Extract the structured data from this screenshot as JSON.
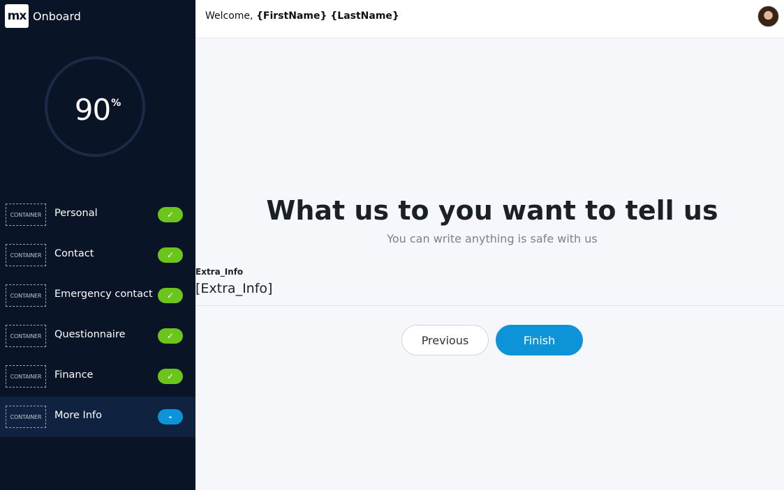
{
  "brand": {
    "logo_text": "mx",
    "name": "Onboard"
  },
  "progress": {
    "value": "90",
    "unit": "%"
  },
  "steps": [
    {
      "container": "CONTAINER",
      "label": "Personal",
      "badge": "✓",
      "status": "done"
    },
    {
      "container": "CONTAINER",
      "label": "Contact",
      "badge": "✓",
      "status": "done"
    },
    {
      "container": "CONTAINER",
      "label": "Emergency contact",
      "badge": "✓",
      "status": "done"
    },
    {
      "container": "CONTAINER",
      "label": "Questionnaire",
      "badge": "✓",
      "status": "done"
    },
    {
      "container": "CONTAINER",
      "label": "Finance",
      "badge": "✓",
      "status": "done"
    },
    {
      "container": "CONTAINER",
      "label": "More Info",
      "badge": "-",
      "status": "current"
    }
  ],
  "header": {
    "welcome_prefix": "Welcome, ",
    "user_name": "{FirstName} {LastName}"
  },
  "main": {
    "title": "What us to you want to tell us",
    "subtitle": "You can write anything is safe with us",
    "field": {
      "label": "Extra_Info",
      "value": "[Extra_Info]"
    }
  },
  "buttons": {
    "previous": "Previous",
    "finish": "Finish"
  },
  "colors": {
    "sidebar_bg": "#0a1427",
    "done_badge": "#6cc51c",
    "current_badge": "#0d94d8",
    "accent": "#0c93d8"
  }
}
